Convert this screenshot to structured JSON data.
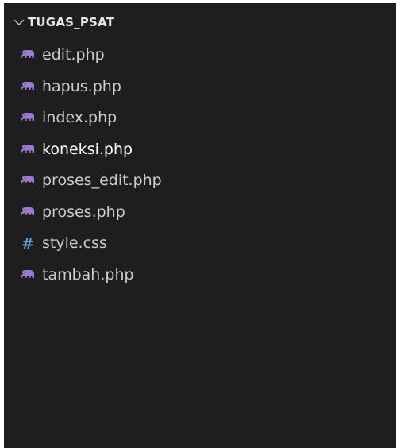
{
  "explorer": {
    "folder_name": "TUGAS_PSAT",
    "expanded_icon": "chevron-down-icon",
    "colors": {
      "background": "#1e1e1e",
      "text": "#cccccc",
      "php_icon": "#9b7bd2",
      "css_icon": "#5ea3d8"
    },
    "files": [
      {
        "name": "edit.php",
        "icon": "php-elephant-icon"
      },
      {
        "name": "hapus.php",
        "icon": "php-elephant-icon"
      },
      {
        "name": "index.php",
        "icon": "php-elephant-icon"
      },
      {
        "name": "koneksi.php",
        "icon": "php-elephant-icon"
      },
      {
        "name": "proses_edit.php",
        "icon": "php-elephant-icon"
      },
      {
        "name": "proses.php",
        "icon": "php-elephant-icon"
      },
      {
        "name": "style.css",
        "icon": "css-hash-icon",
        "glyph": "#"
      },
      {
        "name": "tambah.php",
        "icon": "php-elephant-icon"
      }
    ]
  }
}
